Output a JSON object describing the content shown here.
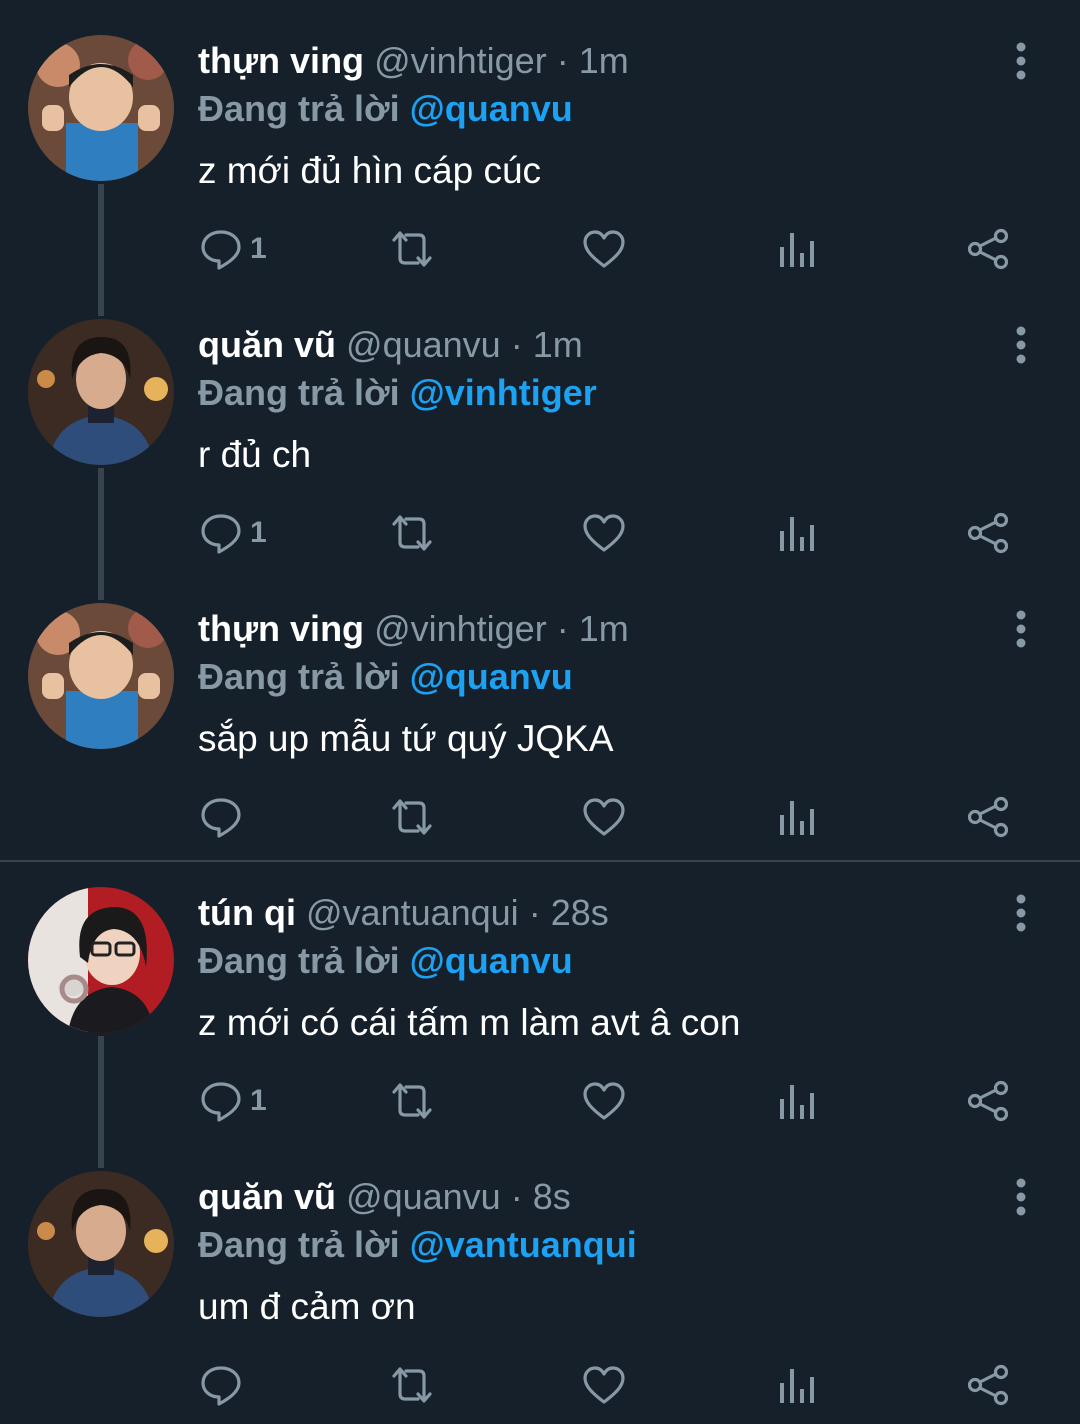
{
  "theme": {
    "background": "#15202b",
    "text": "#ffffff",
    "muted": "#8899a6",
    "accent": "#1da1f2",
    "divider": "#38444d"
  },
  "reply_prefix": "Đang trả lời",
  "tweets": [
    {
      "name": "thựn ving",
      "handle": "@vinhtiger",
      "time": "· 1m",
      "reply_to": "@quanvu",
      "text": "z mới đủ hìn cáp cúc",
      "reply_count": "1",
      "avatar": "kid-avatar"
    },
    {
      "name": "quăn vũ",
      "handle": "@quanvu",
      "time": "· 1m",
      "reply_to": "@vinhtiger",
      "text": "r đủ ch",
      "reply_count": "1",
      "avatar": "man-avatar"
    },
    {
      "name": "thựn ving",
      "handle": "@vinhtiger",
      "time": "· 1m",
      "reply_to": "@quanvu",
      "text": "sắp up mẫu tứ quý JQKA",
      "reply_count": "",
      "avatar": "kid-avatar"
    },
    {
      "name": "tún qi",
      "handle": "@vantuanqui",
      "time": "· 28s",
      "reply_to": "@quanvu",
      "text": "z mới có cái tấm m làm avt â con",
      "reply_count": "1",
      "avatar": "glasses-avatar"
    },
    {
      "name": "quăn vũ",
      "handle": "@quanvu",
      "time": "· 8s",
      "reply_to": "@vantuanqui",
      "text": "um đ cảm ơn",
      "reply_count": "",
      "avatar": "man-avatar"
    }
  ],
  "icons": [
    "reply-icon",
    "retweet-icon",
    "like-icon",
    "analytics-icon",
    "share-icon",
    "more-icon"
  ]
}
